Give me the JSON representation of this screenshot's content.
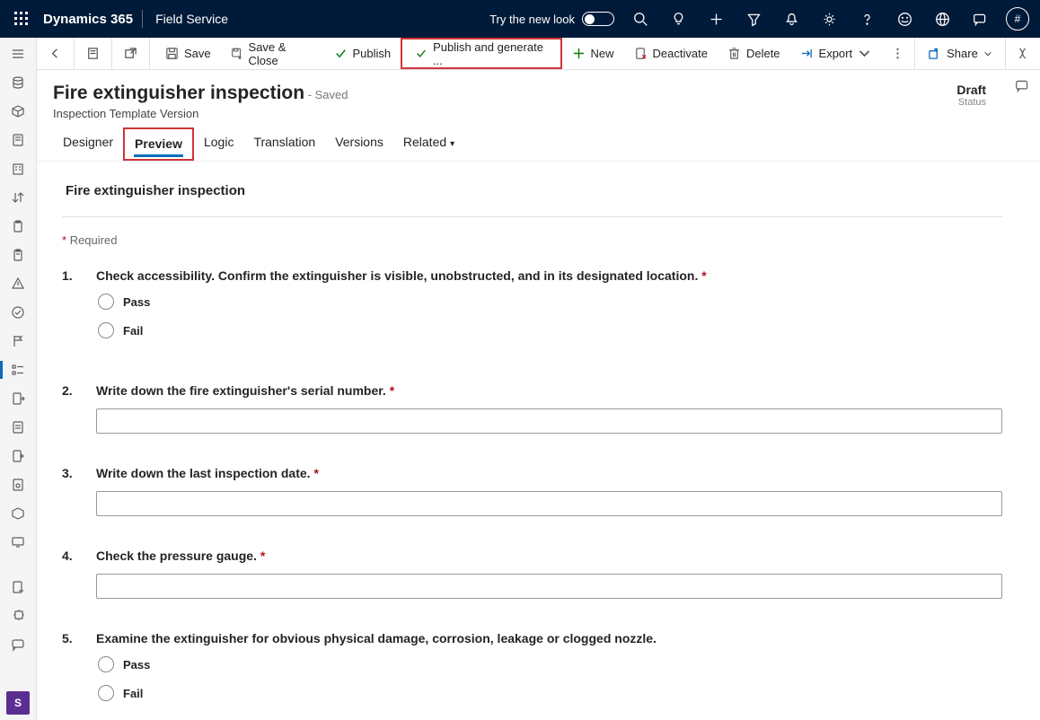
{
  "appbar": {
    "title": "Dynamics 365",
    "area": "Field Service",
    "try_new_look": "Try the new look"
  },
  "commandbar": {
    "save": "Save",
    "save_close": "Save & Close",
    "publish": "Publish",
    "publish_generate": "Publish and generate ...",
    "new": "New",
    "deactivate": "Deactivate",
    "delete": "Delete",
    "export": "Export",
    "share": "Share"
  },
  "header": {
    "title": "Fire extinguisher inspection",
    "saved": "- Saved",
    "subtitle": "Inspection Template Version",
    "status_value": "Draft",
    "status_label": "Status"
  },
  "tabs": {
    "designer": "Designer",
    "preview": "Preview",
    "logic": "Logic",
    "translation": "Translation",
    "versions": "Versions",
    "related": "Related"
  },
  "form": {
    "title": "Fire extinguisher inspection",
    "required_label": "Required",
    "questions": [
      {
        "num": "1.",
        "text": "Check accessibility. Confirm the extinguisher is visible, unobstructed, and in its designated location.",
        "required": true,
        "type": "radio",
        "options": [
          "Pass",
          "Fail"
        ]
      },
      {
        "num": "2.",
        "text": "Write down the fire extinguisher's serial number.",
        "required": true,
        "type": "text"
      },
      {
        "num": "3.",
        "text": "Write down the last inspection date.",
        "required": true,
        "type": "text"
      },
      {
        "num": "4.",
        "text": "Check the pressure gauge.",
        "required": true,
        "type": "text"
      },
      {
        "num": "5.",
        "text": "Examine the extinguisher for obvious physical damage, corrosion, leakage or clogged nozzle.",
        "required": false,
        "type": "radio",
        "options": [
          "Pass",
          "Fail"
        ]
      }
    ]
  }
}
